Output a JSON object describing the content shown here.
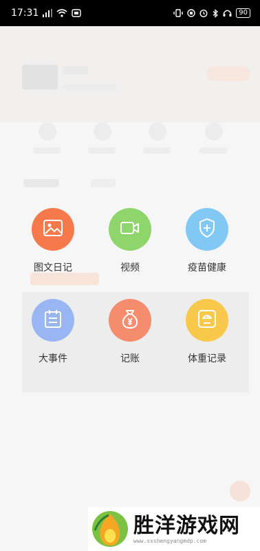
{
  "status_bar": {
    "time": "17:31",
    "left_icons": [
      "mail-icon",
      "wifi-icon",
      "hd-icon"
    ],
    "right_icons": [
      "vibrate-icon",
      "sim-icon",
      "alarm-icon",
      "bluetooth-icon",
      "headphones-icon"
    ],
    "battery": "90"
  },
  "menu": {
    "items": [
      {
        "label": "图文日记",
        "icon": "image-icon",
        "color": "#F5794B"
      },
      {
        "label": "视频",
        "icon": "video-camera-icon",
        "color": "#8ED66B"
      },
      {
        "label": "疫苗健康",
        "icon": "shield-plus-icon",
        "color": "#82C8F5"
      },
      {
        "label": "大事件",
        "icon": "calendar-icon",
        "color": "#9AB6F2"
      },
      {
        "label": "记账",
        "icon": "money-bag-icon",
        "color": "#F58C6E"
      },
      {
        "label": "体重记录",
        "icon": "scale-icon",
        "color": "#F7C84A"
      }
    ]
  },
  "watermark": {
    "title": "胜洋游戏网",
    "url": "www.sxshengyangmdp.com"
  }
}
